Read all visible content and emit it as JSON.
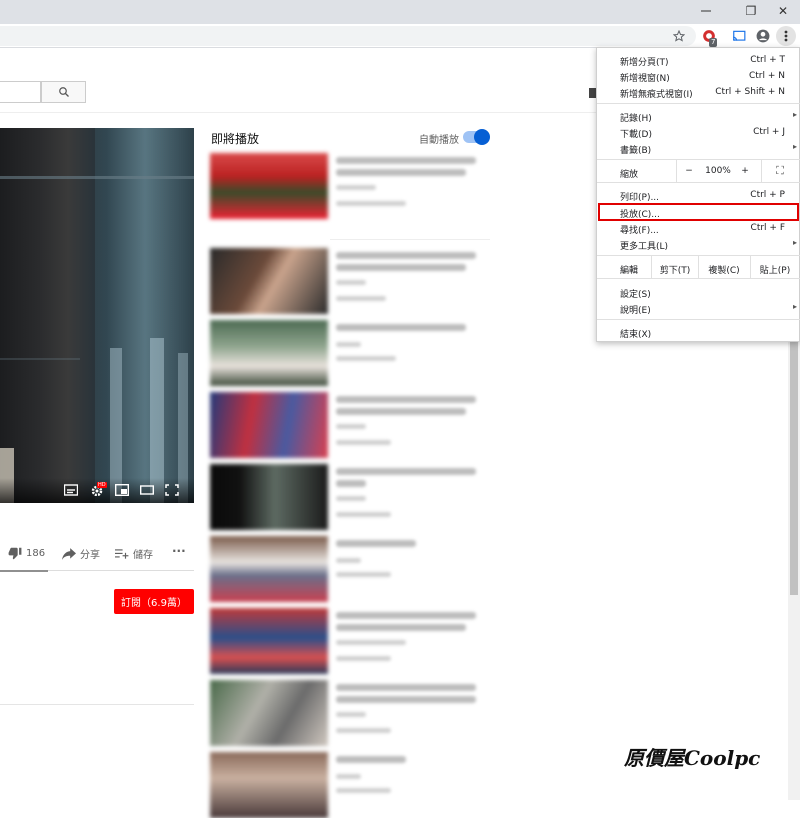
{
  "browser": {
    "window_controls": {
      "restore": "❐",
      "close": "✕"
    },
    "toolbar_icons": [
      "star-icon",
      "extension-icon",
      "cast-icon",
      "account-icon",
      "kebab-menu-icon"
    ],
    "extension_badge": "7"
  },
  "youtube": {
    "search_icon": "search-icon",
    "player_controls": [
      "subtitles-icon",
      "settings-icon",
      "miniplayer-icon",
      "theater-icon",
      "fullscreen-icon"
    ],
    "settings_badge": "HD",
    "actions": {
      "dislike_count": "186",
      "share_label": "分享",
      "save_label": "儲存",
      "more_label": "···"
    },
    "subscribe_label": "訂閱（6.9萬）",
    "up_next": {
      "title": "即將播放",
      "autoplay_label": "自動播放",
      "autoplay_on": true
    }
  },
  "chrome_menu": {
    "items_top": [
      {
        "label": "新增分頁(T)",
        "shortcut": "Ctrl + T"
      },
      {
        "label": "新增視窗(N)",
        "shortcut": "Ctrl + N"
      },
      {
        "label": "新增無痕式視窗(I)",
        "shortcut": "Ctrl + Shift + N"
      }
    ],
    "items_history": [
      {
        "label": "記錄(H)",
        "shortcut": "",
        "submenu": true
      },
      {
        "label": "下載(D)",
        "shortcut": "Ctrl + J"
      },
      {
        "label": "書籤(B)",
        "shortcut": "",
        "submenu": true
      }
    ],
    "zoom": {
      "label": "縮放",
      "minus": "−",
      "value": "100%",
      "plus": "+",
      "fullscreen": "⛶"
    },
    "items_page": [
      {
        "label": "列印(P)...",
        "shortcut": "Ctrl + P"
      },
      {
        "label": "投放(C)...",
        "shortcut": ""
      },
      {
        "label": "尋找(F)...",
        "shortcut": "Ctrl + F"
      },
      {
        "label": "更多工具(L)",
        "shortcut": "",
        "submenu": true
      }
    ],
    "edit": {
      "label": "編輯",
      "cut": "剪下(T)",
      "copy": "複製(C)",
      "paste": "貼上(P)"
    },
    "items_settings": [
      {
        "label": "設定(S)",
        "shortcut": ""
      },
      {
        "label": "說明(E)",
        "shortcut": "",
        "submenu": true
      }
    ],
    "exit": {
      "label": "結束(X)"
    },
    "highlighted_item": "投放(C)..."
  },
  "watermark": "原價屋Coolpc",
  "colors": {
    "subscribe_red": "#ff0000",
    "highlight_red": "#e00000",
    "toggle_blue": "#065fd4"
  }
}
